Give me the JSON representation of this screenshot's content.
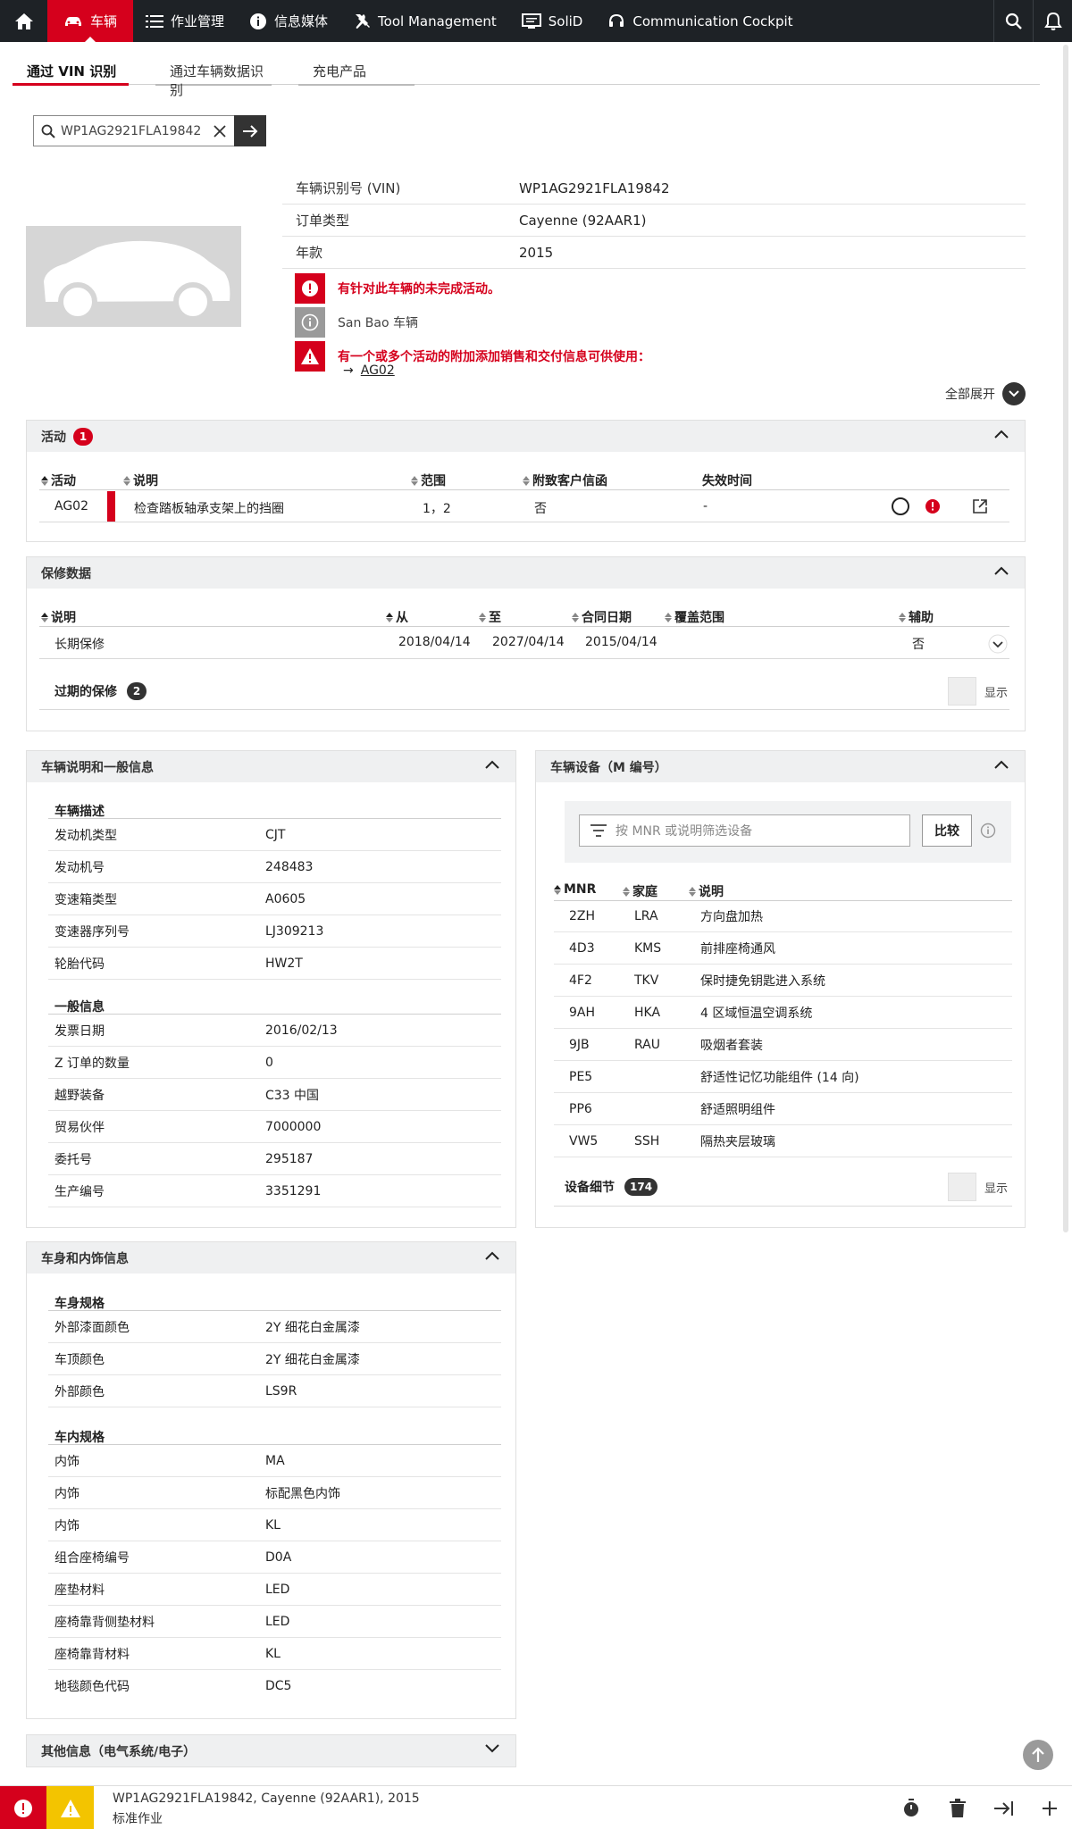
{
  "nav": {
    "items": [
      {
        "label": "车辆",
        "icon": "car-icon",
        "active": true
      },
      {
        "label": "作业管理",
        "icon": "list-icon"
      },
      {
        "label": "信息媒体",
        "icon": "info-icon"
      },
      {
        "label": "Tool Management",
        "icon": "tool-icon"
      },
      {
        "label": "SoliD",
        "icon": "monitor-icon"
      },
      {
        "label": "Communication Cockpit",
        "icon": "headset-icon"
      }
    ]
  },
  "tabs": [
    "通过 VIN 识别",
    "通过车辆数据识别",
    "充电产品"
  ],
  "search": {
    "value": "WP1AG2921FLA19842"
  },
  "summary": {
    "rows": [
      {
        "label": "车辆识别号 (VIN)",
        "value": "WP1AG2921FLA19842"
      },
      {
        "label": "订单类型",
        "value": "Cayenne (92AAR1)"
      },
      {
        "label": "年款",
        "value": "2015"
      }
    ],
    "notices": [
      "有针对此车辆的未完成活动。",
      "San Bao 车辆",
      "有一个或多个活动的附加添加销售和交付信息可供使用："
    ],
    "campaign_link": "AG02",
    "expand_all": "全部展开"
  },
  "activities": {
    "title": "活动",
    "count": "1",
    "headers": [
      "活动",
      "说明",
      "范围",
      "附致客户信函",
      "失效时间"
    ],
    "row": {
      "code": "AG02",
      "desc": "检查踏板轴承支架上的挡圈",
      "scope": "1，2",
      "letter": "否",
      "expiry": "-"
    }
  },
  "warranty": {
    "title": "保修数据",
    "headers": [
      "说明",
      "从",
      "至",
      "合同日期",
      "覆盖范围",
      "辅助"
    ],
    "row": {
      "desc": "长期保修",
      "from": "2018/04/14",
      "to": "2027/04/14",
      "contract": "2015/04/14",
      "coverage": "",
      "aux": "否"
    },
    "expired_label": "过期的保修",
    "expired_count": "2",
    "show_label": "显示"
  },
  "vehicle_info": {
    "title": "车辆说明和一般信息",
    "desc_title": "车辆描述",
    "desc_rows": [
      {
        "k": "发动机类型",
        "v": "CJT"
      },
      {
        "k": "发动机号",
        "v": "248483"
      },
      {
        "k": "变速箱类型",
        "v": "A0605"
      },
      {
        "k": "变速器序列号",
        "v": "LJ309213"
      },
      {
        "k": "轮胎代码",
        "v": "HW2T"
      }
    ],
    "general_title": "一般信息",
    "general_rows": [
      {
        "k": "发票日期",
        "v": "2016/02/13"
      },
      {
        "k": "Z 订单的数量",
        "v": "0"
      },
      {
        "k": "越野装备",
        "v": "C33 中国"
      },
      {
        "k": "贸易伙伴",
        "v": "7000000"
      },
      {
        "k": "委托号",
        "v": "295187"
      },
      {
        "k": "生产编号",
        "v": "3351291"
      }
    ]
  },
  "equipment": {
    "title": "车辆设备（M 编号）",
    "filter_placeholder": "按 MNR 或说明筛选设备",
    "compare_label": "比较",
    "headers": [
      "MNR",
      "家庭",
      "说明"
    ],
    "rows": [
      {
        "mnr": "2ZH",
        "family": "LRA",
        "desc": "方向盘加热"
      },
      {
        "mnr": "4D3",
        "family": "KMS",
        "desc": "前排座椅通风"
      },
      {
        "mnr": "4F2",
        "family": "TKV",
        "desc": "保时捷免钥匙进入系统"
      },
      {
        "mnr": "9AH",
        "family": "HKA",
        "desc": "4 区域恒温空调系统"
      },
      {
        "mnr": "9JB",
        "family": "RAU",
        "desc": "吸烟者套装"
      },
      {
        "mnr": "PE5",
        "family": "",
        "desc": "舒适性记忆功能组件 (14 向)"
      },
      {
        "mnr": "PP6",
        "family": "",
        "desc": "舒适照明组件"
      },
      {
        "mnr": "VW5",
        "family": "SSH",
        "desc": "隔热夹层玻璃"
      }
    ],
    "details_label": "设备细节",
    "details_count": "174",
    "show_label": "显示"
  },
  "body_info": {
    "title": "车身和内饰信息",
    "body_title": "车身规格",
    "body_rows": [
      {
        "k": "外部漆面颜色",
        "v": "2Y 细花白金属漆"
      },
      {
        "k": "车顶颜色",
        "v": "2Y 细花白金属漆"
      },
      {
        "k": "外部颜色",
        "v": "LS9R"
      }
    ],
    "interior_title": "车内规格",
    "interior_rows": [
      {
        "k": "内饰",
        "v": "MA"
      },
      {
        "k": "内饰",
        "v": "标配黑色内饰"
      },
      {
        "k": "内饰",
        "v": "KL"
      },
      {
        "k": "组合座椅编号",
        "v": "D0A"
      },
      {
        "k": "座垫材料",
        "v": "LED"
      },
      {
        "k": "座椅靠背侧垫材料",
        "v": "LED"
      },
      {
        "k": "座椅靠背材料",
        "v": "KL"
      },
      {
        "k": "地毯颜色代码",
        "v": "DC5"
      }
    ]
  },
  "other_info": {
    "title": "其他信息（电气系统/电子）"
  },
  "bottom": {
    "line1": "WP1AG2921FLA19842, Cayenne (92AAR1), 2015",
    "line2": "标准作业"
  },
  "colors": {
    "accent": "#d5001c",
    "nav_bg": "#1e2226",
    "warning": "#f3c400"
  }
}
